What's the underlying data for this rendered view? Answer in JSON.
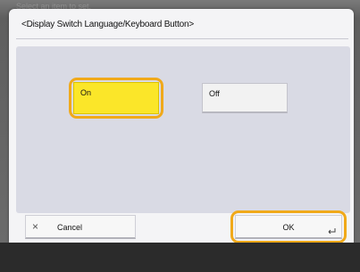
{
  "screen": {
    "hint_text": "Select an item to set."
  },
  "dialog": {
    "title": "<Display Switch Language/Keyboard Button>",
    "options": {
      "on_label": "On",
      "off_label": "Off",
      "selected": "On"
    },
    "buttons": {
      "cancel_label": "Cancel",
      "ok_label": "OK"
    }
  },
  "icons": {
    "cancel": "close-x-icon",
    "ok": "enter-return-icon"
  },
  "colors": {
    "selected_fill": "#fbe629",
    "focus_ring": "#f0a91a",
    "panel_bg": "#d9dae4"
  }
}
